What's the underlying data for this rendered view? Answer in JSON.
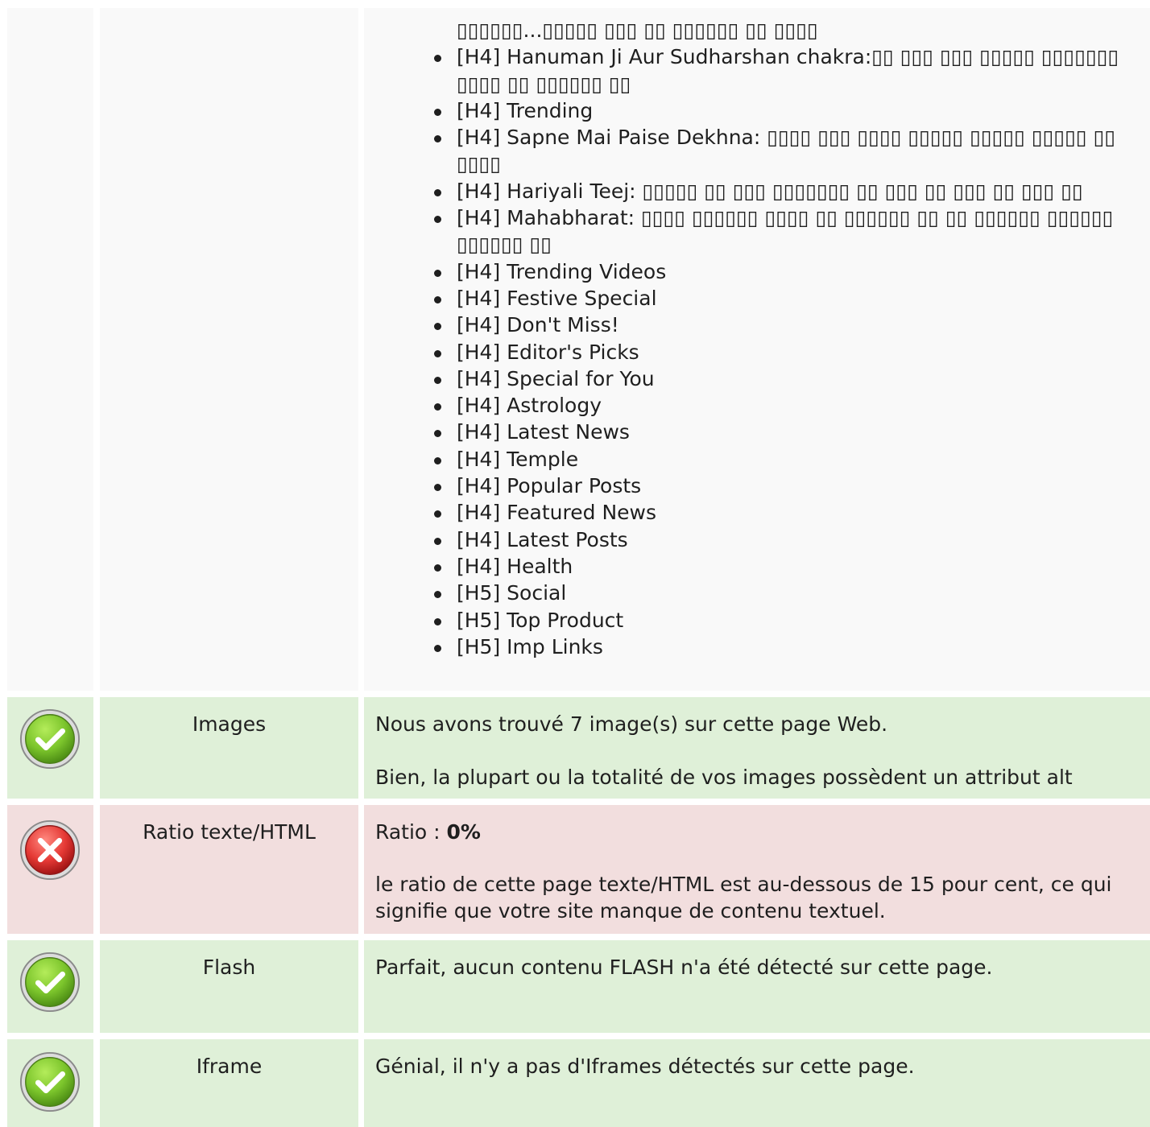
{
  "headings": {
    "continuation_text": "▯▯▯▯▯▯...▯▯▯▯▯ ▯▯▯ ▯▯ ▯▯▯▯▯▯ ▯▯ ▯▯▯▯",
    "items": [
      "[H4] Hanuman Ji Aur Sudharshan chakra:▯▯ ▯▯▯ ▯▯▯ ▯▯▯▯▯ ▯▯▯▯▯▯▯ ▯▯▯▯ ▯▯ ▯▯▯▯▯▯ ▯▯",
      "[H4] Trending",
      "[H4] Sapne Mai Paise Dekhna: ▯▯▯▯ ▯▯▯ ▯▯▯▯ ▯▯▯▯▯ ▯▯▯▯▯ ▯▯▯▯▯ ▯▯ ▯▯▯▯",
      "[H4] Hariyali Teej: ▯▯▯▯▯ ▯▯ ▯▯▯ ▯▯▯▯▯▯▯ ▯▯ ▯▯▯ ▯▯ ▯▯▯ ▯▯ ▯▯▯ ▯▯",
      "[H4] Mahabharat: ▯▯▯▯ ▯▯▯▯▯▯ ▯▯▯▯ ▯▯ ▯▯▯▯▯▯ ▯▯ ▯▯ ▯▯▯▯▯▯ ▯▯▯▯▯▯ ▯▯▯▯▯▯ ▯▯",
      "[H4] Trending Videos",
      "[H4] Festive Special",
      "[H4] Don't Miss!",
      "[H4] Editor's Picks",
      "[H4] Special for You",
      "[H4] Astrology",
      "[H4] Latest News",
      "[H4] Temple",
      "[H4] Popular Posts",
      "[H4] Featured News",
      "[H4] Latest Posts",
      "[H4] Health",
      "[H5] Social",
      "[H5] Top Product",
      "[H5] Imp Links"
    ]
  },
  "images_row": {
    "label": "Images",
    "status": "ok",
    "line1": "Nous avons trouvé 7 image(s) sur cette page Web.",
    "line2": "Bien, la plupart ou la totalité de vos images possèdent un attribut alt"
  },
  "ratio_row": {
    "label": "Ratio texte/HTML",
    "status": "error",
    "ratio_prefix": "Ratio : ",
    "ratio_value": "0%",
    "line2": "le ratio de cette page texte/HTML est au-dessous de 15 pour cent, ce qui signifie que votre site manque de contenu textuel."
  },
  "flash_row": {
    "label": "Flash",
    "status": "ok",
    "line1": "Parfait, aucun contenu FLASH n'a été détecté sur cette page."
  },
  "iframe_row": {
    "label": "Iframe",
    "status": "ok",
    "line1": "Génial, il n'y a pas d'Iframes détectés sur cette page."
  },
  "colors": {
    "ok_bg": "#dff0d8",
    "error_bg": "#f2dede",
    "neutral_bg": "#f9f9f9",
    "ok_icon": "#7cc52c",
    "error_icon": "#e53935"
  }
}
